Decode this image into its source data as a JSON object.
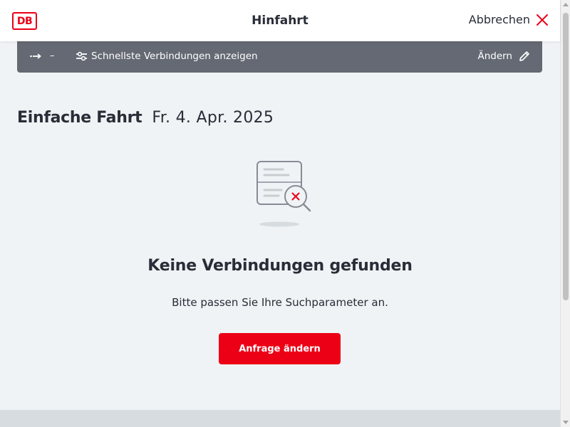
{
  "header": {
    "logo_text": "DB",
    "title": "Hinfahrt",
    "cancel_label": "Abbrechen",
    "cancel_icon": "close-icon"
  },
  "toolbar": {
    "route_icon": "route-arrow-icon",
    "route_text": "–",
    "filter_icon": "sliders-icon",
    "filter_label": "Schnellste Verbindungen anzeigen",
    "change_label": "Ändern",
    "change_icon": "pencil-icon"
  },
  "trip": {
    "type": "Einfache Fahrt",
    "date": "Fr. 4. Apr. 2025"
  },
  "empty_state": {
    "illustration": "document-search-error-icon",
    "title": "Keine Verbindungen gefunden",
    "subtitle": "Bitte passen Sie Ihre Suchparameter an.",
    "button_label": "Anfrage ändern"
  },
  "colors": {
    "brand_red": "#ec0016",
    "toolbar_gray": "#646973",
    "background": "#f0f3f5",
    "text": "#282d37"
  }
}
